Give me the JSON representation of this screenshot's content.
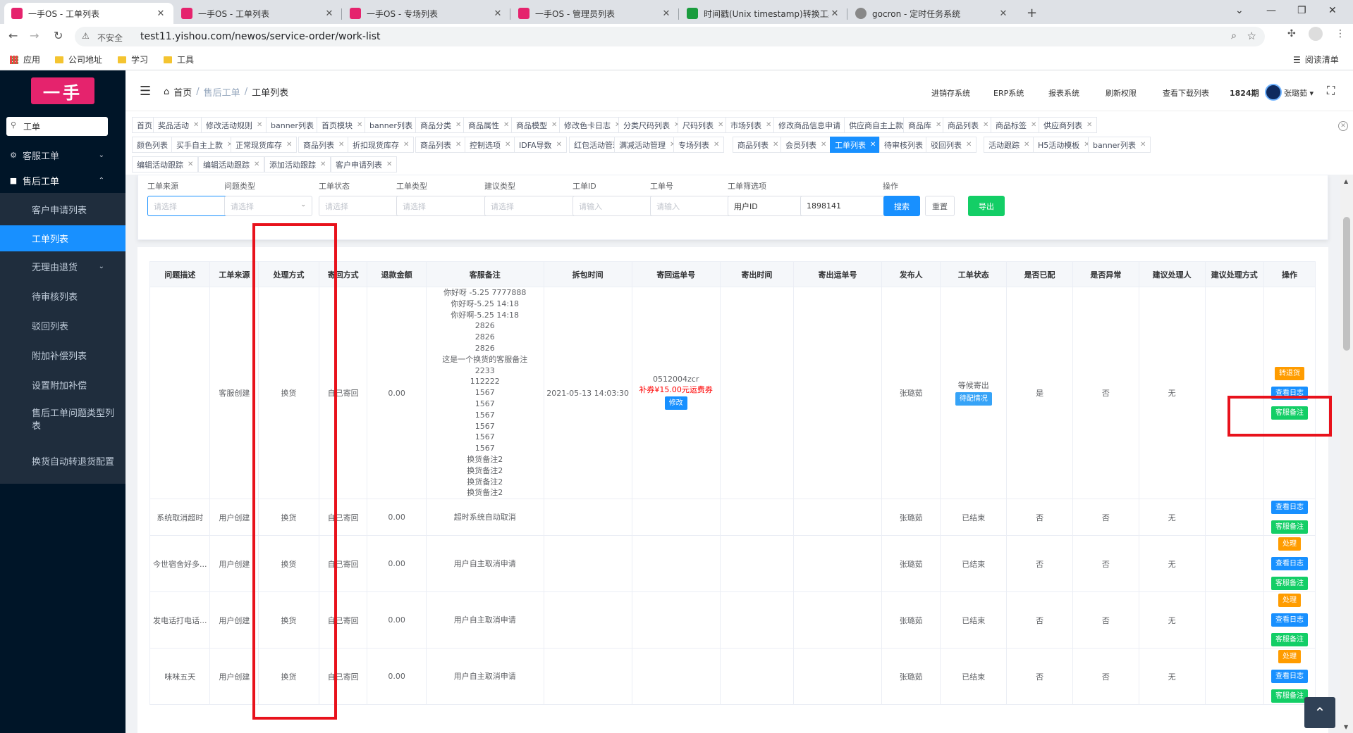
{
  "browser": {
    "tabs": [
      {
        "title": "一手OS - 工单列表",
        "active": true,
        "fav_color": "#e5236d"
      },
      {
        "title": "一手OS - 工单列表",
        "active": false,
        "fav_color": "#e5236d"
      },
      {
        "title": "一手OS - 专场列表",
        "active": false,
        "fav_color": "#e5236d"
      },
      {
        "title": "一手OS - 管理员列表",
        "active": false,
        "fav_color": "#e5236d"
      },
      {
        "title": "时间戳(Unix timestamp)转换工具",
        "active": false,
        "fav_color": "#1a9c3e"
      },
      {
        "title": "gocron - 定时任务系统",
        "active": false,
        "fav_color": "#888888"
      }
    ],
    "insecure_label": "不安全",
    "url": "test11.yishou.com/newos/service-order/work-list",
    "bookmarks": [
      "应用",
      "公司地址",
      "学习",
      "工具"
    ],
    "reading_list": "阅读清单"
  },
  "sidebar": {
    "logo": "一手",
    "search_value": "工单",
    "groups": [
      {
        "label": "客服工单",
        "expanded": false
      },
      {
        "label": "售后工单",
        "expanded": true
      }
    ],
    "items": [
      {
        "label": "客户申请列表",
        "active": false
      },
      {
        "label": "工单列表",
        "active": true
      },
      {
        "label": "无理由退货",
        "active": false,
        "has_children": true
      },
      {
        "label": "待审核列表",
        "active": false
      },
      {
        "label": "驳回列表",
        "active": false
      },
      {
        "label": "附加补偿列表",
        "active": false
      },
      {
        "label": "设置附加补偿",
        "active": false
      },
      {
        "label": "售后工单问题类型列表",
        "active": false
      },
      {
        "label": "换货自动转退货配置",
        "active": false
      }
    ]
  },
  "header": {
    "breadcrumb": [
      "首页",
      "售后工单",
      "工单列表"
    ],
    "links": [
      "进销存系统",
      "ERP系统",
      "报表系统",
      "刷新权限",
      "查看下载列表",
      "1824期"
    ],
    "username": "张璐茹"
  },
  "tags": [
    "首页",
    "奖品活动",
    "修改活动规则",
    "banner列表",
    "首页模块",
    "banner列表",
    "商品分类",
    "商品属性",
    "商品模型",
    "修改色卡日志",
    "分类尺码列表",
    "尺码列表",
    "市场列表",
    "修改商品信息申请",
    "供应商自主上款",
    "商品库",
    "商品列表",
    "商品标签",
    "供应商列表",
    "颜色列表",
    "买手自主上款",
    "正常现货库存",
    "商品列表",
    "折扣现货库存",
    "商品列表",
    "控制选项",
    "IDFA导数",
    "红包活动管理",
    "满减活动管理",
    "专场列表",
    "商品列表",
    "会员列表",
    "工单列表",
    "待审核列表",
    "驳回列表",
    "活动跟踪",
    "H5活动模板",
    "banner列表",
    "编辑活动跟踪",
    "编辑活动跟踪",
    "添加活动跟踪",
    "客户申请列表"
  ],
  "active_tag_index": 32,
  "filter": {
    "fields": [
      {
        "label": "工单来源",
        "placeholder": "请选择",
        "type": "select"
      },
      {
        "label": "问题类型",
        "placeholder": "请选择",
        "type": "select"
      },
      {
        "label": "工单状态",
        "placeholder": "请选择",
        "type": "select"
      },
      {
        "label": "工单类型",
        "placeholder": "请选择",
        "type": "select"
      },
      {
        "label": "建议类型",
        "placeholder": "请选择",
        "type": "select"
      },
      {
        "label": "工单ID",
        "placeholder": "请输入",
        "type": "input"
      },
      {
        "label": "工单号",
        "placeholder": "请输入",
        "type": "input"
      },
      {
        "label": "工单筛选项",
        "value": "用户ID",
        "type": "select"
      }
    ],
    "filter_value": "1898141",
    "action_label": "操作",
    "search_btn": "搜索",
    "reset_btn": "重置",
    "export_btn": "导出"
  },
  "table": {
    "columns": [
      "问题描述",
      "工单来源",
      "处理方式",
      "寄回方式",
      "退款金额",
      "客服备注",
      "拆包时间",
      "寄回运单号",
      "寄出时间",
      "寄出运单号",
      "发布人",
      "工单状态",
      "是否已配",
      "是否异常",
      "建议处理人",
      "建议处理方式",
      "操作"
    ],
    "rows": [
      {
        "desc": "",
        "source": "客服创建",
        "method": "换货",
        "return_method": "自己寄回",
        "refund": "0.00",
        "note_lines": [
          "你好呀 -5.25 7777888",
          "你好呀-5.25 14:18",
          "你好啊-5.25 14:18",
          "2826",
          "2826",
          "2826",
          "这是一个换货的客服备注",
          "2233",
          "112222",
          "1567",
          "1567",
          "1567",
          "1567",
          "1567",
          "1567",
          "换货备注2",
          "换货备注2",
          "换货备注2",
          "换货备注2"
        ],
        "unpack_time": "2021-05-13 14:03:30",
        "return_no": "0512004zcr",
        "return_extra": "补券¥15.00元运费券",
        "return_btn": "修改",
        "send_time": "",
        "send_no": "",
        "publisher": "张璐茹",
        "status": "等候寄出",
        "status_btn": "待配情况",
        "matched": "是",
        "abnormal": "否",
        "handler": "无",
        "handle_way": "",
        "ops": [
          {
            "label": "转退货",
            "color": "orange"
          },
          {
            "label": "查看日志",
            "color": "blue"
          },
          {
            "label": "客服备注",
            "color": "green"
          }
        ]
      },
      {
        "desc": "系统取消超时",
        "source": "用户创建",
        "method": "换货",
        "return_method": "自己寄回",
        "refund": "0.00",
        "note_lines": [
          "超时系统自动取消"
        ],
        "unpack_time": "",
        "return_no": "",
        "return_extra": "",
        "return_btn": "",
        "send_time": "",
        "send_no": "",
        "publisher": "张璐茹",
        "status": "已结束",
        "status_btn": "",
        "matched": "否",
        "abnormal": "否",
        "handler": "无",
        "handle_way": "",
        "ops": [
          {
            "label": "查看日志",
            "color": "blue"
          },
          {
            "label": "客服备注",
            "color": "green"
          }
        ]
      },
      {
        "desc": "今世宿舍好多...",
        "source": "用户创建",
        "method": "换货",
        "return_method": "自己寄回",
        "refund": "0.00",
        "note_lines": [
          "用户自主取消申请"
        ],
        "unpack_time": "",
        "return_no": "",
        "return_extra": "",
        "return_btn": "",
        "send_time": "",
        "send_no": "",
        "publisher": "张璐茹",
        "status": "已结束",
        "status_btn": "",
        "matched": "否",
        "abnormal": "否",
        "handler": "无",
        "handle_way": "",
        "ops": [
          {
            "label": "处理",
            "color": "orange"
          },
          {
            "label": "查看日志",
            "color": "blue"
          },
          {
            "label": "客服备注",
            "color": "green"
          }
        ]
      },
      {
        "desc": "发电话打电话...",
        "source": "用户创建",
        "method": "换货",
        "return_method": "自己寄回",
        "refund": "0.00",
        "note_lines": [
          "用户自主取消申请"
        ],
        "unpack_time": "",
        "return_no": "",
        "return_extra": "",
        "return_btn": "",
        "send_time": "",
        "send_no": "",
        "publisher": "张璐茹",
        "status": "已结束",
        "status_btn": "",
        "matched": "否",
        "abnormal": "否",
        "handler": "无",
        "handle_way": "",
        "ops": [
          {
            "label": "处理",
            "color": "orange"
          },
          {
            "label": "查看日志",
            "color": "blue"
          },
          {
            "label": "客服备注",
            "color": "green"
          }
        ]
      },
      {
        "desc": "咪咪五天",
        "source": "用户创建",
        "method": "换货",
        "return_method": "自己寄回",
        "refund": "0.00",
        "note_lines": [
          "用户自主取消申请"
        ],
        "unpack_time": "",
        "return_no": "",
        "return_extra": "",
        "return_btn": "",
        "send_time": "",
        "send_no": "",
        "publisher": "张璐茹",
        "status": "已结束",
        "status_btn": "",
        "matched": "否",
        "abnormal": "否",
        "handler": "无",
        "handle_way": "",
        "ops": [
          {
            "label": "处理",
            "color": "orange"
          },
          {
            "label": "查看日志",
            "color": "blue"
          },
          {
            "label": "客服备注",
            "color": "green"
          }
        ]
      }
    ]
  },
  "colors": {
    "accent": "#1890ff",
    "brand": "#e5236d",
    "highlight": "#e8121c",
    "sidebar_bg": "#001528"
  }
}
